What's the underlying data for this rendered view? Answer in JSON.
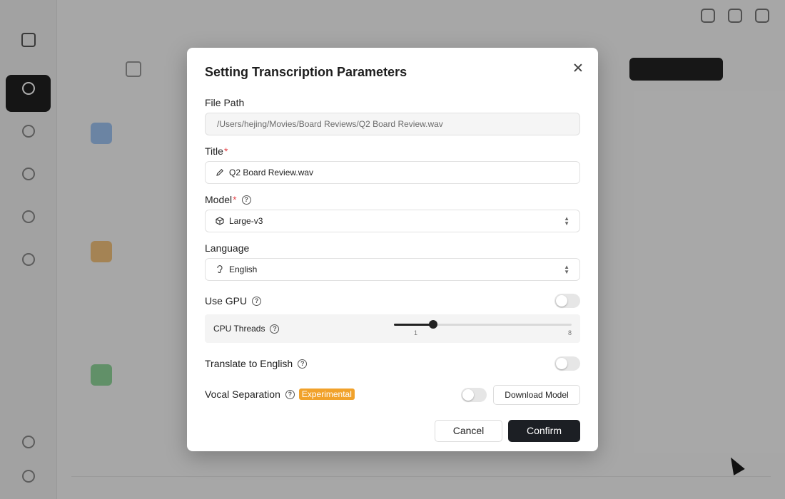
{
  "modal": {
    "title": "Setting Transcription Parameters",
    "file_path": {
      "label": "File Path",
      "value": "/Users/hejing/Movies/Board Reviews/Q2 Board Review.wav"
    },
    "title_field": {
      "label": "Title",
      "required_mark": "*",
      "value": "Q2 Board Review.wav",
      "icon": "pencil-icon"
    },
    "model": {
      "label": "Model",
      "required_mark": "*",
      "value": "Large-v3",
      "icon": "cube-icon"
    },
    "language": {
      "label": "Language",
      "value": "English",
      "icon": "language-icon"
    },
    "use_gpu": {
      "label": "Use GPU",
      "enabled": false
    },
    "cpu_threads": {
      "label": "CPU Threads",
      "min": "1",
      "max": "8",
      "value": 3
    },
    "translate": {
      "label": "Translate to English",
      "enabled": false
    },
    "vocal_separation": {
      "label": "Vocal Separation",
      "badge": "Experimental",
      "enabled": false,
      "download_label": "Download Model"
    },
    "cancel_label": "Cancel",
    "confirm_label": "Confirm"
  },
  "colors": {
    "accent": "#1c1f24",
    "badge": "#f1a22b",
    "required": "#e5484d"
  }
}
